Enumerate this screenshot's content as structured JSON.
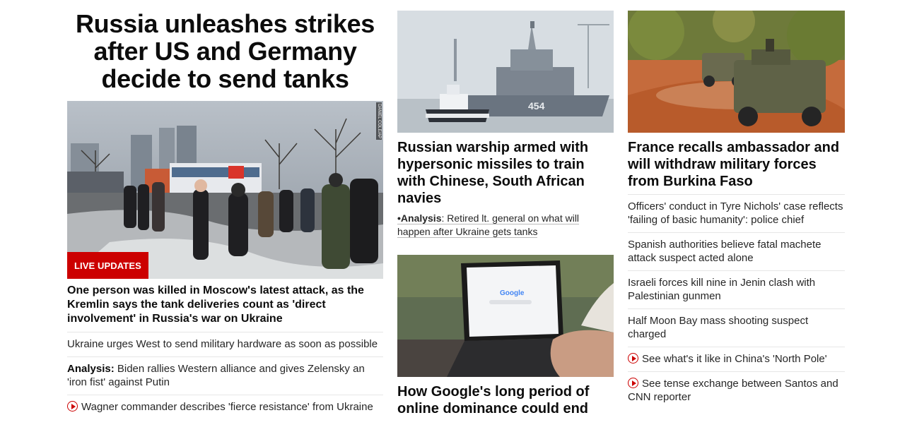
{
  "left": {
    "headline": "Russia unleashes strikes after US and Germany decide to send tanks",
    "hero_badge": "LIVE UPDATES",
    "hero_credit": "DANIEL COLE/AP",
    "lead": "One person was killed in Moscow's latest attack, as the Kremlin says the tank deliveries count as 'direct involvement' in Russia's war on Ukraine",
    "items": [
      {
        "text": "Ukraine urges West to send military hardware as soon as possible"
      },
      {
        "prefix": "Analysis:",
        "text": "Biden rallies Western alliance and gives Zelensky an 'iron fist' against Putin"
      },
      {
        "text": "Wagner commander describes 'fierce resistance' from Ukraine",
        "icon": "play-icon"
      }
    ]
  },
  "middle": {
    "card1_title": "Russian warship armed with hypersonic missiles to train with Chinese, South African navies",
    "card1_hull_number": "454",
    "card1_analysis_prefix": "•Analysis",
    "card1_analysis_text": ": Retired lt. general on what will happen after Ukraine gets tanks",
    "card2_title": "How Google's long period of online dominance could end",
    "card2_screen_logo": "Google"
  },
  "right": {
    "card_title": "France recalls ambassador and will withdraw military forces from Burkina Faso",
    "items": [
      {
        "text": "Officers' conduct in Tyre Nichols' case reflects 'failing of basic humanity': police chief"
      },
      {
        "text": "Spanish authorities believe fatal machete attack suspect acted alone"
      },
      {
        "text": "Israeli forces kill nine in Jenin clash with Palestinian gunmen"
      },
      {
        "text": "Half Moon Bay mass shooting suspect charged"
      },
      {
        "text": "See what's it like in China's 'North Pole'",
        "icon": "play-icon"
      },
      {
        "text": "See tense exchange between Santos and CNN reporter",
        "icon": "play-icon"
      }
    ]
  },
  "colors": {
    "accent_red": "#cc0000",
    "text": "#0c0c0c",
    "divider": "#e6e6e6"
  }
}
